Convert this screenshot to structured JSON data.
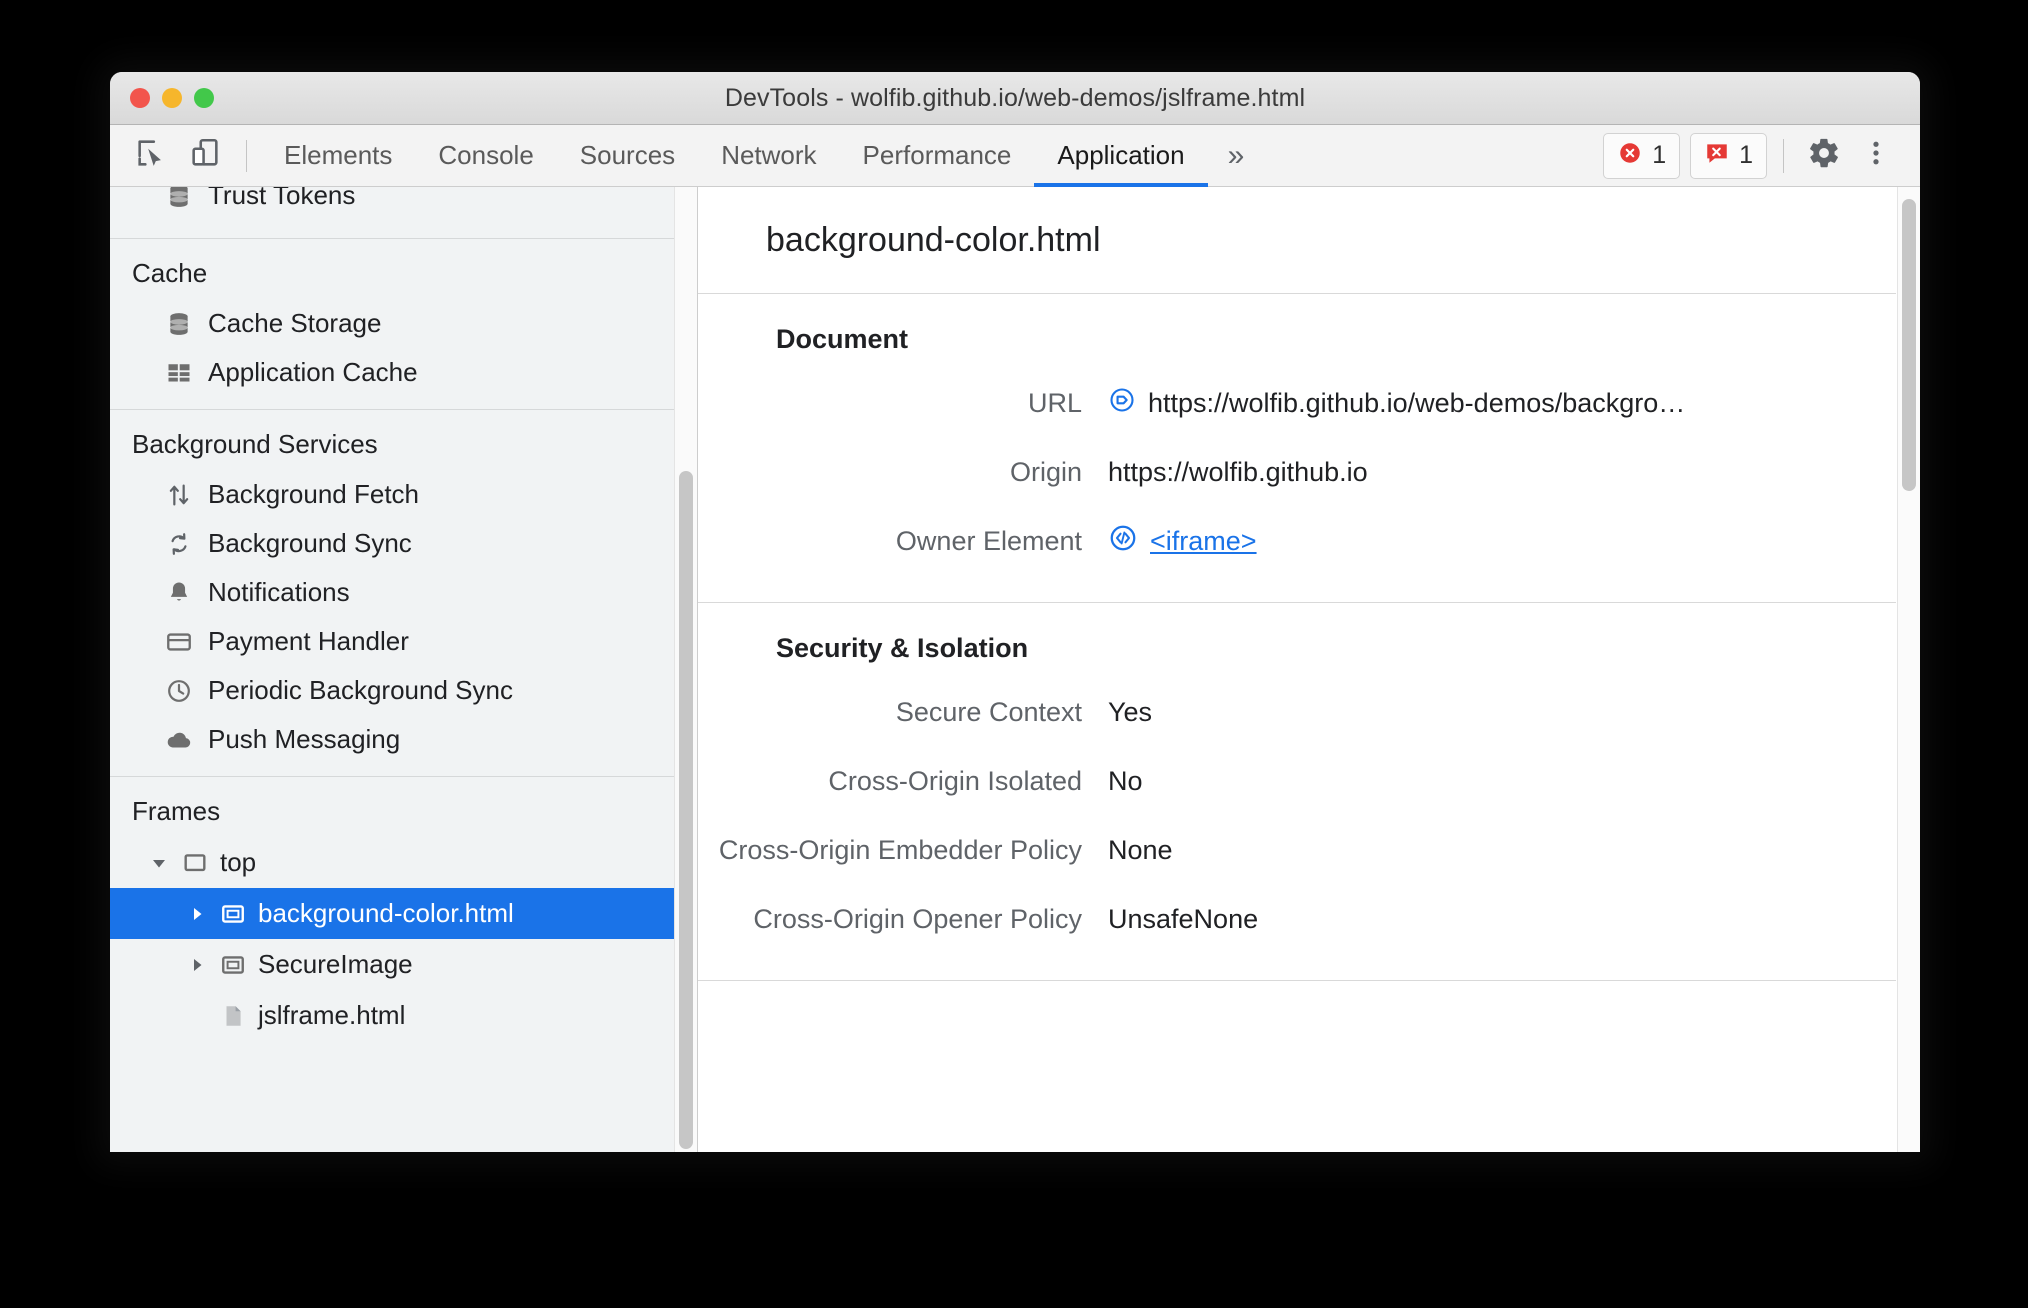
{
  "window": {
    "title": "DevTools - wolfib.github.io/web-demos/jslframe.html",
    "traffic_lights": [
      "close",
      "minimize",
      "zoom"
    ]
  },
  "toolbar": {
    "inspect_icon": "inspect-element-icon",
    "device_icon": "device-toolbar-icon",
    "tabs": [
      {
        "label": "Elements",
        "active": false
      },
      {
        "label": "Console",
        "active": false
      },
      {
        "label": "Sources",
        "active": false
      },
      {
        "label": "Network",
        "active": false
      },
      {
        "label": "Performance",
        "active": false
      },
      {
        "label": "Application",
        "active": true
      }
    ],
    "more_tabs_label": "»",
    "errors_badge": {
      "icon": "error-circle-icon",
      "count": "1"
    },
    "warnings_badge": {
      "icon": "console-message-icon",
      "count": "1"
    },
    "settings_icon": "gear-icon",
    "menu_icon": "kebab-menu-icon"
  },
  "sidebar": {
    "groups": [
      {
        "title": null,
        "items": [
          {
            "label": "Trust Tokens",
            "icon": "database-icon"
          }
        ]
      },
      {
        "title": "Cache",
        "items": [
          {
            "label": "Cache Storage",
            "icon": "database-icon"
          },
          {
            "label": "Application Cache",
            "icon": "table-icon"
          }
        ]
      },
      {
        "title": "Background Services",
        "items": [
          {
            "label": "Background Fetch",
            "icon": "arrows-up-down-icon"
          },
          {
            "label": "Background Sync",
            "icon": "sync-icon"
          },
          {
            "label": "Notifications",
            "icon": "bell-icon"
          },
          {
            "label": "Payment Handler",
            "icon": "credit-card-icon"
          },
          {
            "label": "Periodic Background Sync",
            "icon": "clock-icon"
          },
          {
            "label": "Push Messaging",
            "icon": "cloud-icon"
          }
        ]
      }
    ],
    "frames": {
      "title": "Frames",
      "tree": [
        {
          "label": "top",
          "level": 1,
          "arrow": "expanded",
          "icon": "frame-icon",
          "selected": false
        },
        {
          "label": "background-color.html",
          "level": 2,
          "arrow": "collapsed",
          "icon": "iframe-icon",
          "selected": true
        },
        {
          "label": "SecureImage",
          "level": 2,
          "arrow": "collapsed",
          "icon": "iframe-icon",
          "selected": false
        },
        {
          "label": "jslframe.html",
          "level": 2,
          "arrow": "none",
          "icon": "document-icon",
          "selected": false
        }
      ]
    }
  },
  "main": {
    "header_title": "background-color.html",
    "sections": [
      {
        "title": "Document",
        "rows": [
          {
            "key": "URL",
            "value": "https://wolfib.github.io/web-demos/backgro…",
            "icon": "reveal-in-sources-icon",
            "link": false
          },
          {
            "key": "Origin",
            "value": "https://wolfib.github.io",
            "icon": null,
            "link": false
          },
          {
            "key": "Owner Element",
            "value": "<iframe>",
            "icon": "code-badge-icon",
            "link": true
          }
        ]
      },
      {
        "title": "Security & Isolation",
        "rows": [
          {
            "key": "Secure Context",
            "value": "Yes",
            "icon": null,
            "link": false
          },
          {
            "key": "Cross-Origin Isolated",
            "value": "No",
            "icon": null,
            "link": false
          },
          {
            "key": "Cross-Origin Embedder Policy",
            "value": "None",
            "icon": null,
            "link": false
          },
          {
            "key": "Cross-Origin Opener Policy",
            "value": "UnsafeNone",
            "icon": null,
            "link": false
          }
        ]
      }
    ]
  },
  "colors": {
    "accent": "#1a73e8",
    "error": "#e53935",
    "selection": "#1a73e8",
    "sidebar_bg": "#f1f3f4",
    "panel_bg": "#ffffff"
  }
}
